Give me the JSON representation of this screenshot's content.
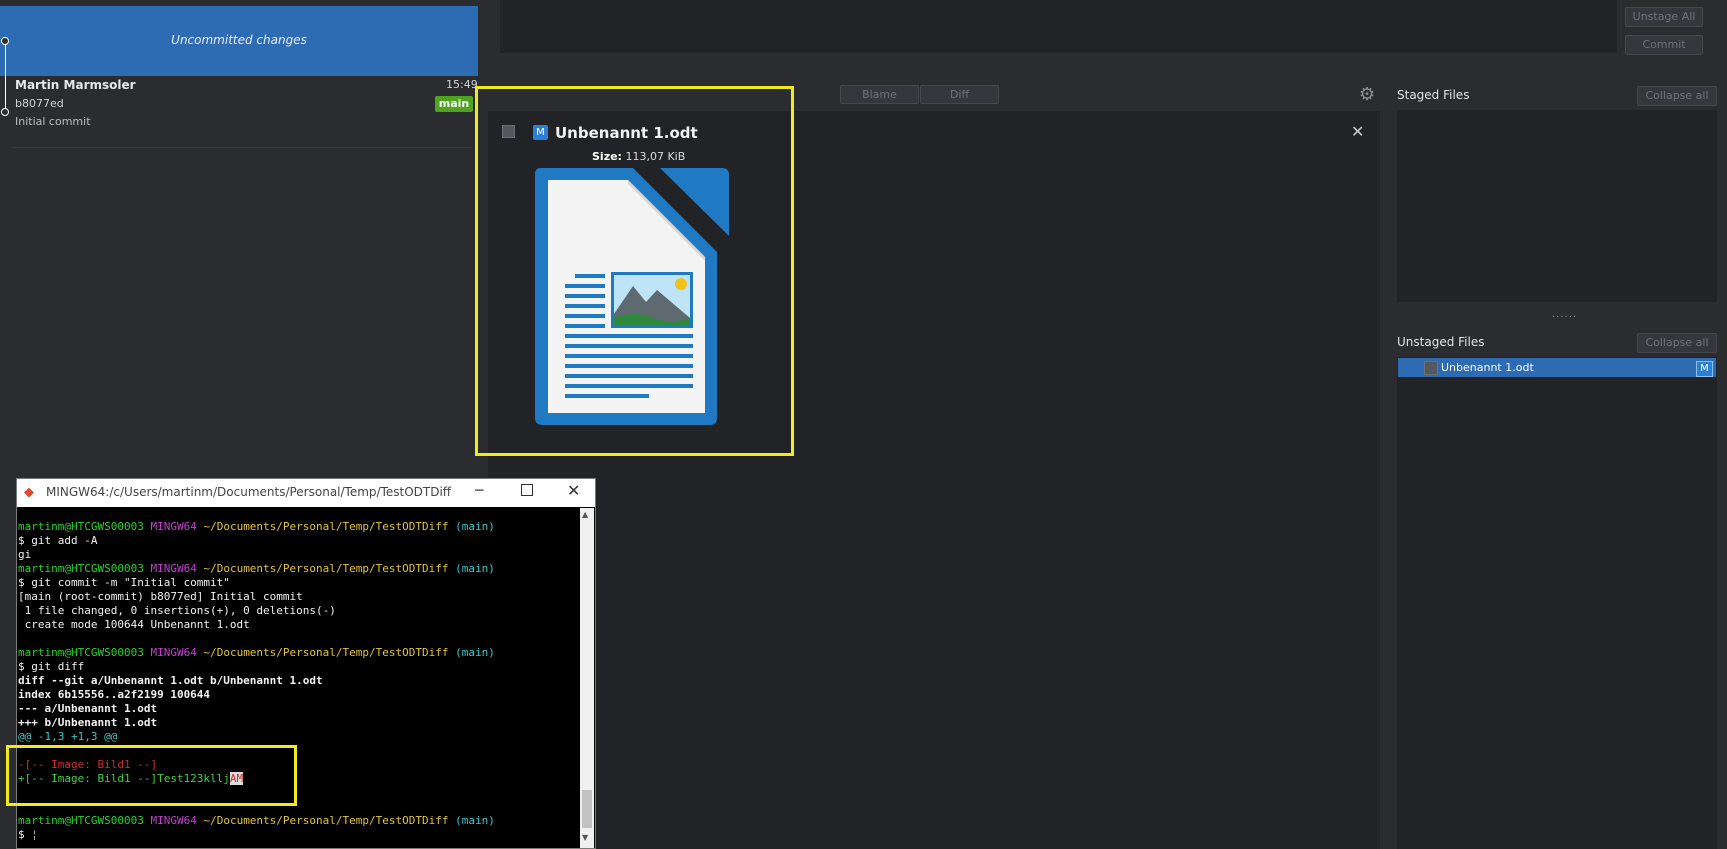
{
  "history": {
    "uncommitted_label": "Uncommitted changes",
    "commit": {
      "author": "Martin Marmsoler",
      "time": "15:49",
      "hash": "b8077ed",
      "message": "Initial commit",
      "branch": "main"
    }
  },
  "commit_area": {
    "unstage_all_label": "Unstage All",
    "commit_label": "Commit"
  },
  "diff_toolbar": {
    "blame_label": "Blame",
    "diff_label": "Diff",
    "settings_icon": "gear-icon"
  },
  "diff_view": {
    "status_badge": "M",
    "file_name": "Unbenannt 1.odt",
    "size_label": "Size:",
    "size_value": "113,07 KiB",
    "file_icon": "libreoffice-writer-document-icon"
  },
  "staged": {
    "title": "Staged Files",
    "collapse_label": "Collapse all",
    "splitter": "......"
  },
  "unstaged": {
    "title": "Unstaged Files",
    "collapse_label": "Collapse all",
    "items": [
      {
        "name": "Unbenannt 1.odt",
        "status": "M"
      }
    ]
  },
  "terminal": {
    "title": "MINGW64:/c/Users/martinm/Documents/Personal/Temp/TestODTDiff",
    "prompt_user": "martinm@HTCGWS00003",
    "prompt_env": "MINGW64",
    "prompt_path": "~/Documents/Personal/Temp/TestODTDiff",
    "prompt_branch": "(main)",
    "lines": {
      "cmd1": "$ git add -A",
      "out1": "gi",
      "cmd2": "$ git commit -m \"Initial commit\"",
      "out2a": "[main (root-commit) b8077ed] Initial commit",
      "out2b": " 1 file changed, 0 insertions(+), 0 deletions(-)",
      "out2c": " create mode 100644 Unbenannt 1.odt",
      "cmd3": "$ git diff",
      "d1": "diff --git a/Unbenannt 1.odt b/Unbenannt 1.odt",
      "d2": "index 6b15556..a2f2199 100644",
      "d3": "--- a/Unbenannt 1.odt",
      "d4": "+++ b/Unbenannt 1.odt",
      "d5": "@@ -1,3 +1,3 @@",
      "del": "-[-- Image: Bild1 --]",
      "add_prefix": "+[-- Image: Bild1 --]Test123kllj",
      "add_marker": "AM",
      "final_prompt": "$ "
    }
  }
}
